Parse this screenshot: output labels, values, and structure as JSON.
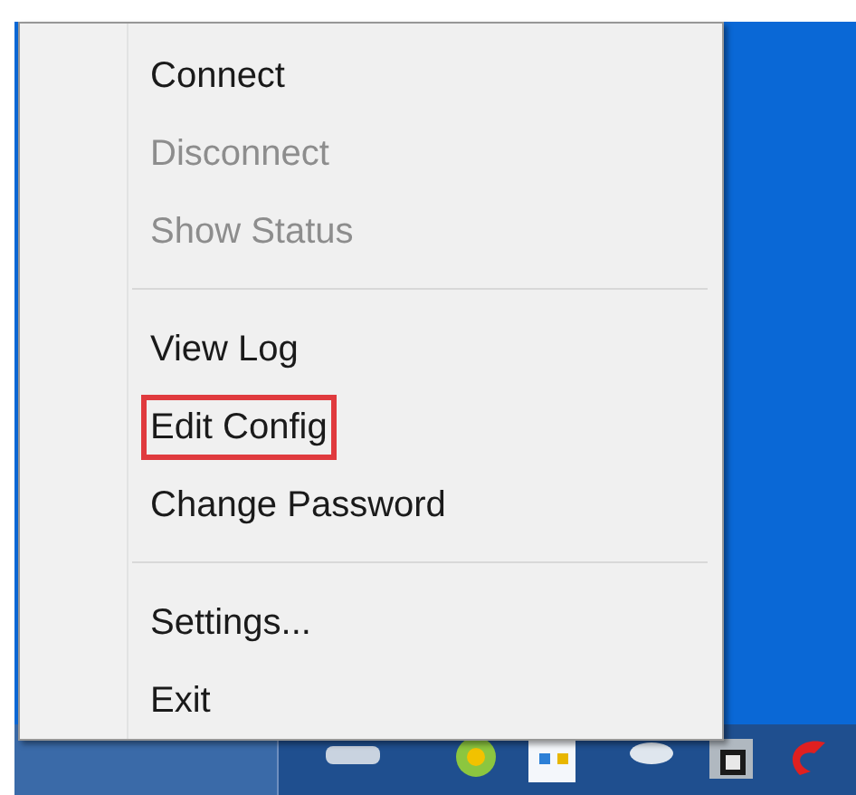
{
  "menu": {
    "items": [
      {
        "kind": "item",
        "label": "Connect",
        "disabled": false,
        "highlighted": false
      },
      {
        "kind": "item",
        "label": "Disconnect",
        "disabled": true,
        "highlighted": false
      },
      {
        "kind": "item",
        "label": "Show Status",
        "disabled": true,
        "highlighted": false
      },
      {
        "kind": "separator"
      },
      {
        "kind": "item",
        "label": "View Log",
        "disabled": false,
        "highlighted": false
      },
      {
        "kind": "item",
        "label": "Edit Config",
        "disabled": false,
        "highlighted": true
      },
      {
        "kind": "item",
        "label": "Change Password",
        "disabled": false,
        "highlighted": false
      },
      {
        "kind": "separator"
      },
      {
        "kind": "item",
        "label": "Settings...",
        "disabled": false,
        "highlighted": false
      },
      {
        "kind": "item",
        "label": "Exit",
        "disabled": false,
        "highlighted": false
      }
    ]
  }
}
